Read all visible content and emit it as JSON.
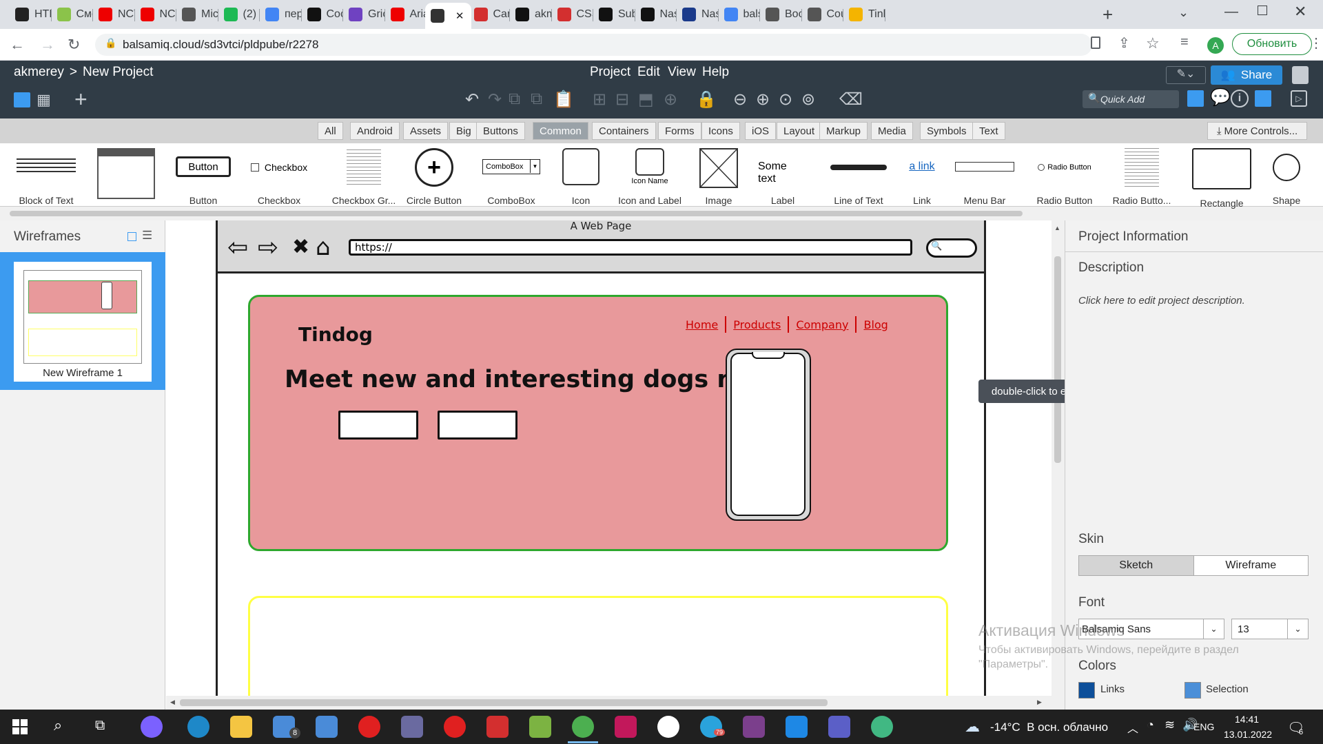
{
  "browser": {
    "tabs": [
      {
        "label": "HTM",
        "icon": "w-icon",
        "color": "#222"
      },
      {
        "label": "Смо",
        "icon": "site-icon",
        "color": "#8bc34a"
      },
      {
        "label": "NCT",
        "icon": "youtube-icon",
        "color": "#e00"
      },
      {
        "label": "NCT",
        "icon": "youtube-icon",
        "color": "#e00"
      },
      {
        "label": "Mic",
        "icon": "globe-icon",
        "color": "#555"
      },
      {
        "label": "(2) \\",
        "icon": "z-icon",
        "color": "#1db954"
      },
      {
        "label": "пер",
        "icon": "google-icon",
        "color": "#4285f4"
      },
      {
        "label": "Coc",
        "icon": "c-icon",
        "color": "#111"
      },
      {
        "label": "Gric",
        "icon": "b-icon",
        "color": "#6f42c1"
      },
      {
        "label": "Aria",
        "icon": "youtube-icon",
        "color": "#e00"
      },
      {
        "label": "",
        "icon": "smiley-icon",
        "color": "#333",
        "active": true
      },
      {
        "label": "Car",
        "icon": "ui-icon",
        "color": "#d32f2f"
      },
      {
        "label": "akm",
        "icon": "github-icon",
        "color": "#111"
      },
      {
        "label": "CSS",
        "icon": "star-icon",
        "color": "#d32f2f"
      },
      {
        "label": "Sub",
        "icon": "globe-icon",
        "color": "#111"
      },
      {
        "label": "Nas",
        "icon": "w-icon",
        "color": "#111"
      },
      {
        "label": "Nas",
        "icon": "50-icon",
        "color": "#1a3a8a"
      },
      {
        "label": "bals",
        "icon": "google-icon",
        "color": "#4285f4"
      },
      {
        "label": "Boc",
        "icon": "globe-icon",
        "color": "#555"
      },
      {
        "label": "Cou",
        "icon": "gear-icon",
        "color": "#555"
      },
      {
        "label": "Tinl",
        "icon": "drive-icon",
        "color": "#f4b400"
      }
    ],
    "url": "balsamiq.cloud/sd3vtci/pldpube/r2278",
    "update_label": "Обновить",
    "avatar_letter": "A"
  },
  "app": {
    "breadcrumb_user": "akmerey",
    "breadcrumb_sep": ">",
    "breadcrumb_project": "New Project",
    "menus": [
      "Project",
      "Edit",
      "View",
      "Help"
    ],
    "share_label": "Share",
    "quick_add_placeholder": "Quick Add"
  },
  "categories": [
    "All",
    "Android",
    "Assets",
    "Big",
    "Buttons",
    "Common",
    "Containers",
    "Forms",
    "Icons",
    "iOS",
    "Layout",
    "Markup",
    "Media",
    "Symbols",
    "Text"
  ],
  "active_category": "Common",
  "more_controls": "More Controls...",
  "palette": [
    {
      "label": "Block of Text"
    },
    {
      "label": ""
    },
    {
      "label": "Button",
      "preview": "Button"
    },
    {
      "label": "Checkbox",
      "preview": "Checkbox"
    },
    {
      "label": "Checkbox Gr..."
    },
    {
      "label": "Circle Button"
    },
    {
      "label": "ComboBox",
      "preview": "ComboBox"
    },
    {
      "label": "Icon"
    },
    {
      "label": "Icon and Label",
      "preview": "Icon Name"
    },
    {
      "label": "Image"
    },
    {
      "label": "Label",
      "preview": "Some text"
    },
    {
      "label": "Line of Text"
    },
    {
      "label": "Link",
      "preview": "a link"
    },
    {
      "label": "Menu Bar"
    },
    {
      "label": "Radio Button",
      "preview": "Radio Button"
    },
    {
      "label": "Radio Butto..."
    },
    {
      "label": "Rectangle"
    },
    {
      "label": "Shape"
    }
  ],
  "wireframes": {
    "title": "Wireframes",
    "items": [
      {
        "name": "New Wireframe 1"
      }
    ]
  },
  "mockup": {
    "window_title": "A Web Page",
    "url": "https://",
    "brand": "Tindog",
    "nav": [
      "Home",
      "Products",
      "Company",
      "Blog"
    ],
    "headline": "Meet new and interesting dogs nearby",
    "hero_color": "#e8999b",
    "hero_border": "#2ea82e",
    "section_border": "#ffff44"
  },
  "tooltip": "double-click to edit",
  "project_info": {
    "title": "Project Information",
    "description_label": "Description",
    "description_text": "Click here to edit project description.",
    "skin_label": "Skin",
    "skin_options": [
      "Sketch",
      "Wireframe"
    ],
    "skin_selected": "Sketch",
    "font_label": "Font",
    "font_value": "Balsamiq Sans",
    "font_size": "13",
    "colors_label": "Colors",
    "links_label": "Links",
    "selection_label": "Selection"
  },
  "watermark": {
    "line1": "Активация Windows",
    "line2": "Чтобы активировать Windows, перейдите в раздел",
    "line3": "\"Параметры\"."
  },
  "taskbar": {
    "weather": "-14°C  В осн. облачно",
    "lang": "ENG",
    "time": "14:41",
    "date": "13.01.2022",
    "notif_count": "6",
    "mail_badge": "8",
    "telegram_badge": "79"
  }
}
